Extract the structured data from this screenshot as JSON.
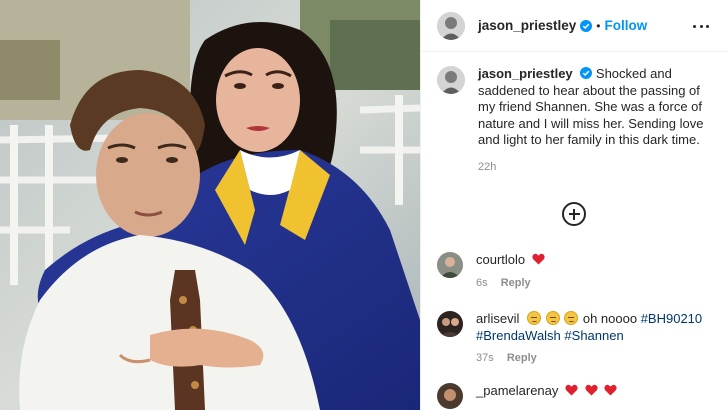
{
  "post": {
    "author": "jason_priestley",
    "follow_label": "Follow",
    "separator": "•",
    "caption_text": "Shocked and saddened to hear about the passing of my friend Shannen. She was a force of nature and I will miss her. Sending love and light to her family in this dark time.",
    "time_ago": "22h"
  },
  "comments": [
    {
      "user": "courtlolo",
      "text": "",
      "time": "6s",
      "reply_label": "Reply"
    },
    {
      "user": "arlisevil",
      "text": "oh noooo",
      "tags": [
        "#BH90210",
        "#BrendaWalsh",
        "#Shannen"
      ],
      "time": "37s",
      "reply_label": "Reply"
    },
    {
      "user": "_pamelarenay",
      "text": ""
    }
  ],
  "icons": {
    "verified": "verified-badge-icon",
    "more": "more-options-icon",
    "load_more": "plus-circle-icon",
    "heart": "red-heart-emoji",
    "sad_face": "disappointed-face-emoji"
  },
  "colors": {
    "link_blue": "#0095f6",
    "hashtag": "#00376b",
    "muted": "#8e8e8e",
    "heart_red": "#e0202f"
  }
}
